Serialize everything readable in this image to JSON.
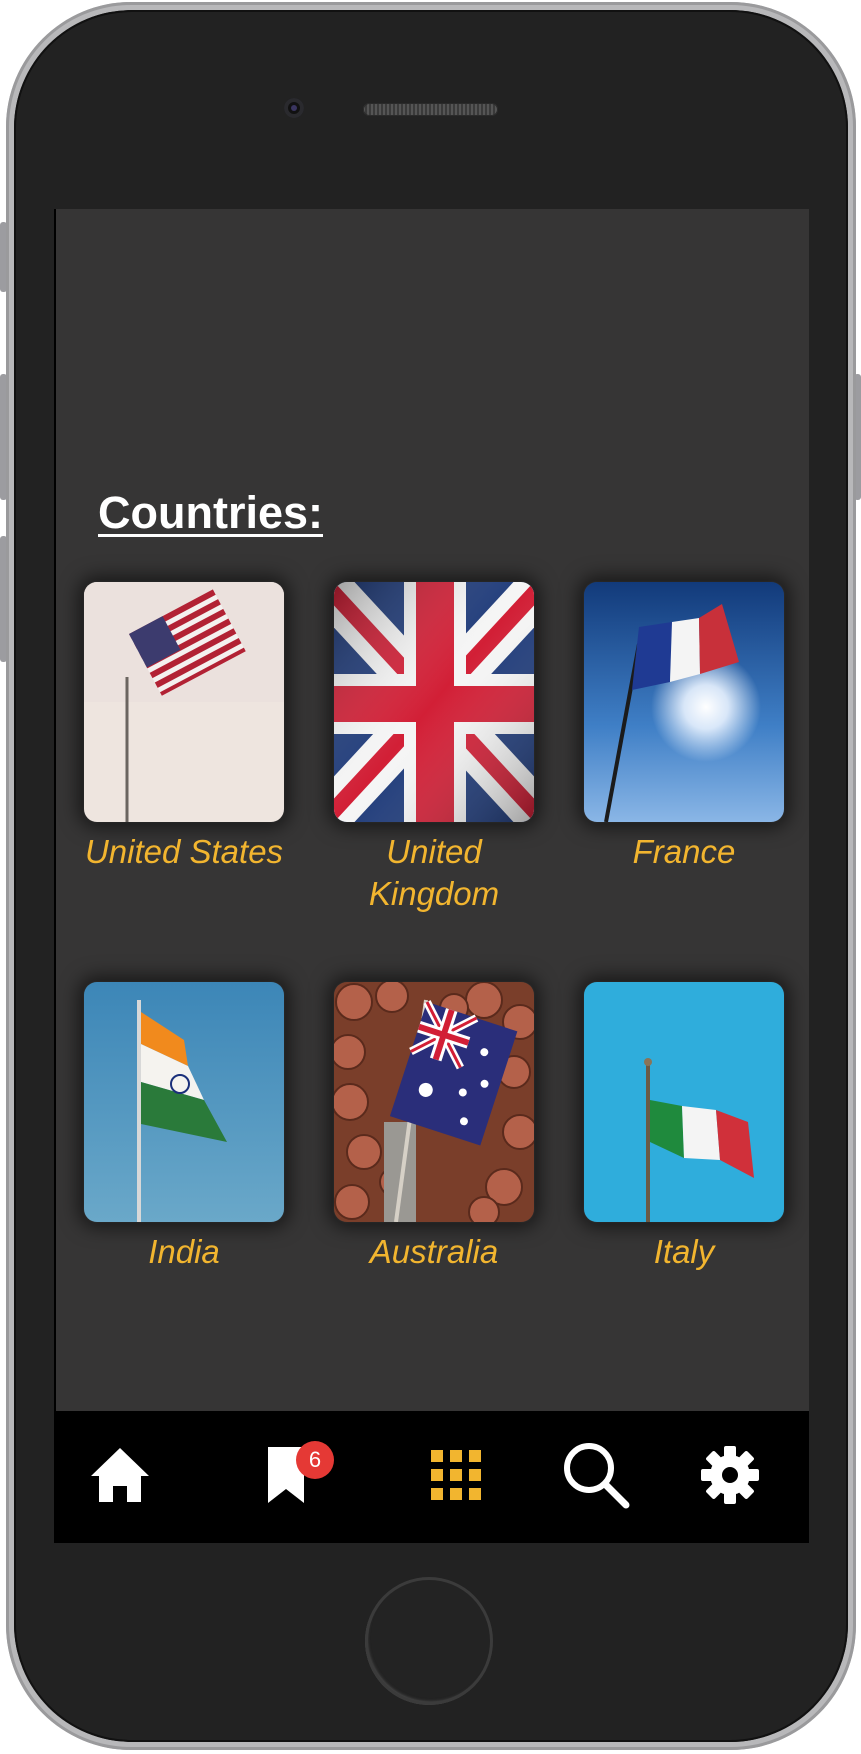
{
  "section": {
    "title": "Countries:"
  },
  "countries": [
    {
      "name": "United States"
    },
    {
      "name": "United Kingdom"
    },
    {
      "name": "France"
    },
    {
      "name": "India"
    },
    {
      "name": "Australia"
    },
    {
      "name": "Italy"
    }
  ],
  "tabbar": {
    "items": [
      {
        "icon": "home-icon",
        "selected": false
      },
      {
        "icon": "bookmark-icon",
        "badge": "6",
        "selected": false
      },
      {
        "icon": "grid-icon",
        "selected": true
      },
      {
        "icon": "search-icon",
        "selected": false
      },
      {
        "icon": "gear-icon",
        "selected": false
      }
    ]
  },
  "colors": {
    "screen_background": "#363535",
    "label_accent": "#f2b52f",
    "tab_active": "#f2b52f",
    "tab_inactive": "#ffffff",
    "badge": "#e53935",
    "tabbar_background": "#000000"
  }
}
